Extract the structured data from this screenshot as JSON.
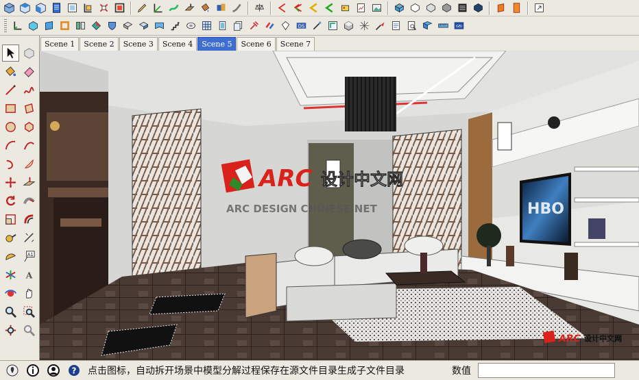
{
  "scenes": {
    "tabs": [
      {
        "label": "Scene 1"
      },
      {
        "label": "Scene 2"
      },
      {
        "label": "Scene 3"
      },
      {
        "label": "Scene 4"
      },
      {
        "label": "Scene 5"
      },
      {
        "label": "Scene 6"
      },
      {
        "label": "Scene 7"
      }
    ],
    "active_index": 4
  },
  "watermark": {
    "brand": "ARC",
    "brand_cn": "设计中文网",
    "subtitle": "ARC DESIGN CHINESE NET"
  },
  "statusbar": {
    "message": "点击图标，自动拆开场景中模型分解过程保存在源文件目录生成子文件目录",
    "measure_label": "数值",
    "measure_value": ""
  },
  "tv": {
    "logo": "HBO"
  },
  "colors": {
    "accent": "#3e6fd0",
    "brand_red": "#d9221b"
  }
}
